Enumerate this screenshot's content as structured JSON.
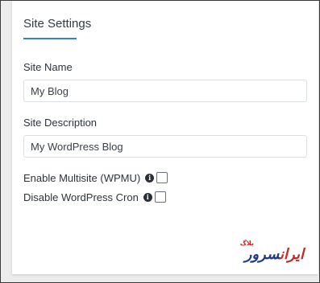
{
  "panel": {
    "title": "Site Settings"
  },
  "fields": {
    "site_name": {
      "label": "Site Name",
      "value": "My Blog"
    },
    "site_description": {
      "label": "Site Description",
      "value": "My WordPress Blog"
    }
  },
  "options": {
    "multisite": {
      "label": "Enable Multisite (WPMU)",
      "checked": false
    },
    "cron": {
      "label": "Disable WordPress Cron",
      "checked": false
    }
  },
  "watermark": {
    "small": "بلاگ",
    "main_part1": "ایران",
    "main_part2": "سرور"
  },
  "colors": {
    "accent": "#2f80d1",
    "brand_blue": "#1f3c88",
    "brand_red": "#c62828"
  },
  "icons": {
    "info": "info-icon"
  }
}
